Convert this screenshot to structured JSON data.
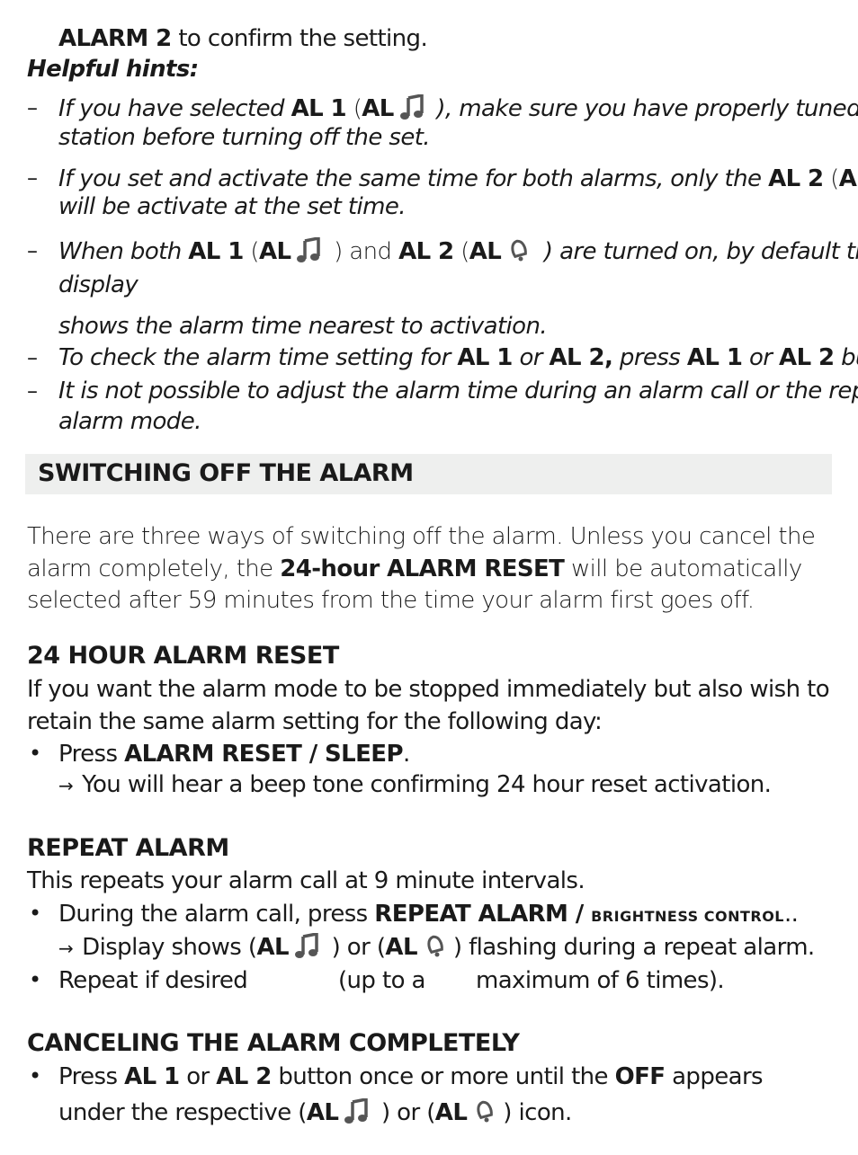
{
  "intro": {
    "confirm_bold": "ALARM 2",
    "confirm_text": " to confirm the setting.",
    "hints_title": "Helpful hints:"
  },
  "hints": {
    "h1_a": "If you have selected ",
    "h1_b": "AL 1",
    "h1_c": " (",
    "h1_d": "AL",
    "h1_e": " ), make sure you have properly tuned to a",
    "h1_line2": "station before turning off the set.",
    "h2_a": "If you set and activate the same time for both alarms, only the ",
    "h2_b": "AL 2",
    "h2_c": " (",
    "h2_d": "AL",
    "h2_e": ")",
    "h2_line2": "will be activate at the set time.",
    "h3_a": "When both ",
    "h3_b": "AL 1",
    "h3_c": " (",
    "h3_d": "AL",
    "h3_e": " ) and ",
    "h3_f": "AL 2",
    "h3_g": " (",
    "h3_h": "AL",
    "h3_i": " ) are turned on, by default the",
    "h3_line2": "display",
    "h3_line3": "shows the alarm time nearest to activation.",
    "h4_a": "To check the alarm time setting for ",
    "h4_b": "AL 1",
    "h4_c": " or ",
    "h4_d": "AL 2,",
    "h4_e": " press ",
    "h4_f": "AL 1",
    "h4_g": " or ",
    "h4_h": "AL 2",
    "h4_i": " button.",
    "h5_line1": "It is not possible to adjust the alarm time during an alarm call or the repeat",
    "h5_line2": "alarm mode."
  },
  "section": {
    "title": "SWITCHING OFF THE ALARM",
    "p1": "There are three ways of switching off the alarm. Unless you cancel the",
    "p2_a": "alarm completely, the ",
    "p2_b": "24-hour ALARM RESET",
    "p2_c": " will be automatically",
    "p3": "selected after 59 minutes from the time your alarm first goes off."
  },
  "reset": {
    "heading": "24 HOUR ALARM RESET",
    "p1": "If you want the alarm mode to be stopped immediately but also wish to",
    "p2": "retain the same alarm setting for the following day:",
    "bullet_a": "Press ",
    "bullet_b": "ALARM RESET / SLEEP",
    "bullet_c": ".",
    "arrow": "→",
    "result": "You will hear a beep tone confirming 24 hour reset activation."
  },
  "repeat": {
    "heading": "REPEAT ALARM",
    "p1": "This repeats your alarm call at 9 minute intervals.",
    "bullet1_a": "During the alarm call, press ",
    "bullet1_b": "REPEAT ALARM / ",
    "bullet1_c": "BRIGHTNESS CONTROL",
    "bullet1_d": "..",
    "arrow": "→",
    "res_a": "Display shows  (",
    "res_b": "AL",
    "res_c": " )  or (",
    "res_d": "AL",
    "res_e": ") flashing  during a repeat alarm.",
    "bullet2_a": "Repeat if desired",
    "bullet2_b": "(up to a",
    "bullet2_c": "maximum of 6 times)."
  },
  "cancel": {
    "heading": "CANCELING THE ALARM COMPLETELY",
    "b_a": "Press ",
    "b_b": "AL 1",
    "b_c": " or ",
    "b_d": "AL 2",
    "b_e": " button once or more until the ",
    "b_f": "OFF",
    "b_g": " appears",
    "l2_a": "under the respective (",
    "l2_b": "AL",
    "l2_c": " )  or (",
    "l2_d": "AL",
    "l2_e": ") icon."
  },
  "icons": {
    "note": "music-note-icon",
    "bell": "bell-icon",
    "icon_color": "#555555"
  },
  "bullet_char": "•",
  "dash_char": "–"
}
